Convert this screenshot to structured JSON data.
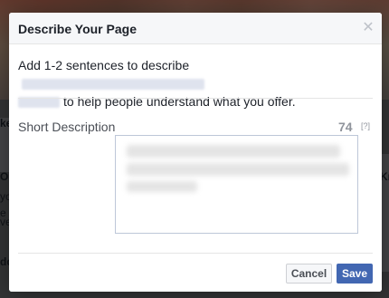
{
  "dialog": {
    "title": "Describe Your Page",
    "close_icon": "close-icon",
    "intro_prefix": "Add 1-2 sentences to describe",
    "intro_suffix": "to help people understand what you offer.",
    "field_label": "Short Description",
    "char_count": "74",
    "help_label": "[?]"
  },
  "footer": {
    "cancel_label": "Cancel",
    "save_label": "Save"
  },
  "background": {
    "fragments": [
      "ke",
      "O",
      "yo",
      "e",
      "ve",
      "Kr",
      "dd"
    ]
  },
  "colors": {
    "primary": "#4267b2",
    "header_bg": "#f6f7f9",
    "text": "#1d2129",
    "muted": "#90949c"
  }
}
